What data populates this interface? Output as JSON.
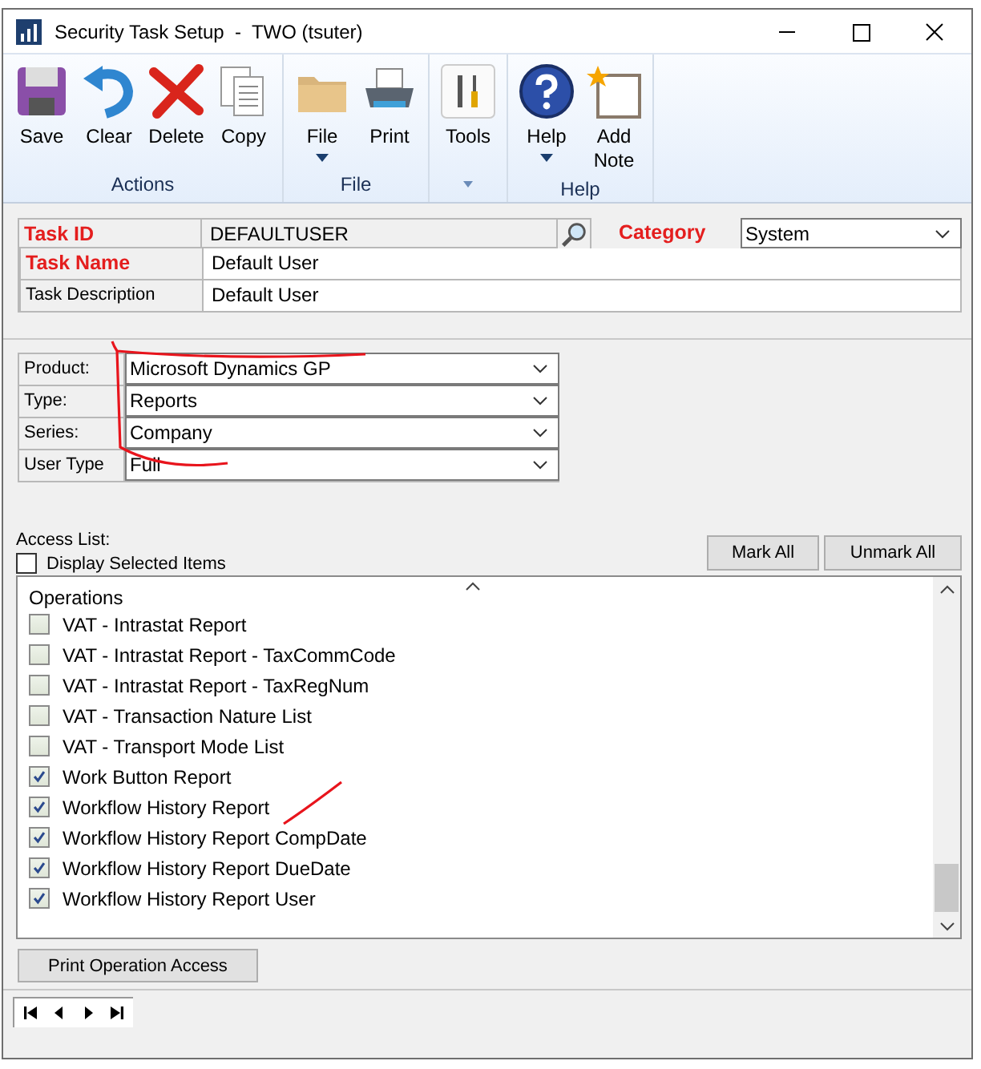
{
  "window": {
    "title": "Security Task Setup  -  TWO (tsuter)"
  },
  "ribbon": {
    "groups": [
      {
        "label": "Actions",
        "buttons": [
          {
            "label": "Save",
            "dropdown": false
          },
          {
            "label": "Clear",
            "dropdown": false
          },
          {
            "label": "Delete",
            "dropdown": false
          },
          {
            "label": "Copy",
            "dropdown": false
          }
        ]
      },
      {
        "label": "File",
        "buttons": [
          {
            "label": "File",
            "dropdown": true
          },
          {
            "label": "Print",
            "dropdown": false
          }
        ]
      },
      {
        "buttons": [
          {
            "label": "Tools",
            "dropdown": false
          }
        ]
      },
      {
        "label": "Help",
        "buttons": [
          {
            "label": "Help",
            "dropdown": true
          },
          {
            "label": "Add Note",
            "dropdown": false
          }
        ]
      }
    ]
  },
  "header": {
    "task_id": {
      "label": "Task ID",
      "value": "DEFAULTUSER",
      "required": true
    },
    "category": {
      "label": "Category",
      "value": "System",
      "required": true
    },
    "task_name": {
      "label": "Task Name",
      "value": "Default User",
      "required": true
    },
    "task_description": {
      "label": "Task Description",
      "value": "Default User",
      "required": false
    }
  },
  "filters": [
    {
      "label": "Product:",
      "value": "Microsoft Dynamics GP"
    },
    {
      "label": "Type:",
      "value": "Reports"
    },
    {
      "label": "Series:",
      "value": "Company"
    },
    {
      "label": "User Type",
      "value": "Full"
    }
  ],
  "access_list": {
    "label": "Access List:",
    "display_selected": {
      "label": "Display Selected Items",
      "checked": false
    },
    "buttons": [
      "Mark All",
      "Unmark All"
    ],
    "column": "Operations",
    "items": [
      {
        "label": "VAT - Intrastat Report",
        "checked": false
      },
      {
        "label": "VAT - Intrastat Report - TaxCommCode",
        "checked": false
      },
      {
        "label": "VAT - Intrastat Report - TaxRegNum",
        "checked": false
      },
      {
        "label": "VAT - Transaction Nature List",
        "checked": false
      },
      {
        "label": "VAT - Transport Mode List",
        "checked": false
      },
      {
        "label": "Work Button Report",
        "checked": true
      },
      {
        "label": "Workflow History Report",
        "checked": true
      },
      {
        "label": "Workflow History Report CompDate",
        "checked": true
      },
      {
        "label": "Workflow History Report DueDate",
        "checked": true
      },
      {
        "label": "Workflow History Report User",
        "checked": true
      }
    ]
  },
  "print_button": "Print Operation Access"
}
